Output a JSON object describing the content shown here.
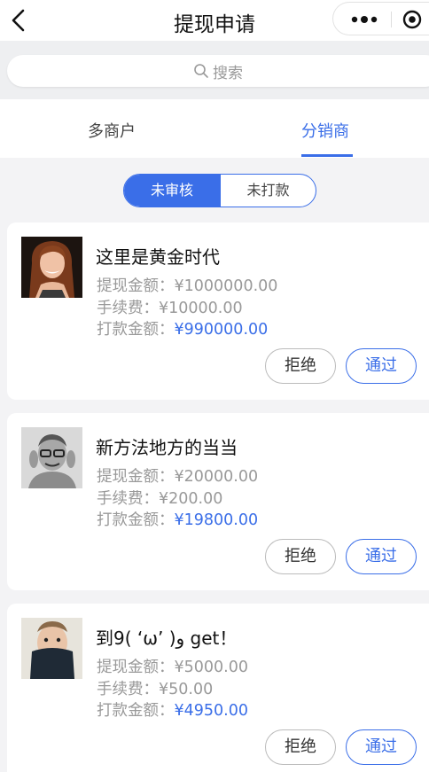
{
  "navbar": {
    "title": "提现申请"
  },
  "search": {
    "placeholder": "搜索"
  },
  "tabs": [
    {
      "label": "多商户",
      "active": false
    },
    {
      "label": "分销商",
      "active": true
    }
  ],
  "filter": [
    {
      "label": "未审核",
      "active": true
    },
    {
      "label": "未打款",
      "active": false
    }
  ],
  "labels": {
    "amount": "提现金额：",
    "fee": "手续费：",
    "payout": "打款金额："
  },
  "buttons": {
    "reject": "拒绝",
    "pass": "通过"
  },
  "records": [
    {
      "name": "这里是黄金时代",
      "amount": "¥1000000.00",
      "fee": "¥10000.00",
      "payout": "¥990000.00"
    },
    {
      "name": "新方法地方的当当",
      "amount": "¥20000.00",
      "fee": "¥200.00",
      "payout": "¥19800.00"
    },
    {
      "name": "到9( ‘ω’ )و get！",
      "amount": "¥5000.00",
      "fee": "¥50.00",
      "payout": "¥4950.00"
    }
  ],
  "colors": {
    "accent": "#3a6ee8",
    "background": "#f3f3f5"
  }
}
